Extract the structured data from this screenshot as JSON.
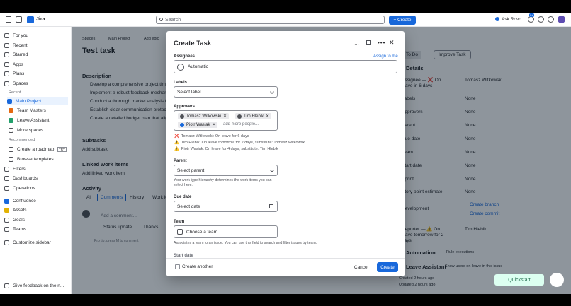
{
  "topbar": {
    "app_name": "Jira",
    "search_placeholder": "Search",
    "create_label": "+ Create",
    "ask_rovo": "Ask Rovo",
    "notif_count": "9+"
  },
  "sidebar": {
    "items": [
      {
        "label": "For you"
      },
      {
        "label": "Recent"
      },
      {
        "label": "Starred"
      },
      {
        "label": "Apps"
      },
      {
        "label": "Plans"
      },
      {
        "label": "Spaces"
      }
    ],
    "recent_heading": "Recent",
    "recent": [
      "Main Project",
      "Team Masters",
      "Leave Assistant",
      "More spaces"
    ],
    "recommended_heading": "Recommended",
    "recommended": [
      "Create a roadmap",
      "Browse templates"
    ],
    "try_badge": "TRY",
    "bottom": [
      "Filters",
      "Dashboards",
      "Operations",
      "Confluence",
      "Assets",
      "Goals",
      "Teams",
      "Customize sidebar"
    ],
    "feedback": "Give feedback on the n..."
  },
  "page": {
    "breadcrumb": [
      "Spaces",
      "Main Project",
      "Add epic"
    ],
    "title": "Test task",
    "description_heading": "Description",
    "description_items": [
      "Develop a comprehensive project timel...",
      "Implement a robust feedback mechan...",
      "Conduct a thorough market analysis to...",
      "Establish clear communication protoco...",
      "Create a detailed budget plan that align..."
    ],
    "subtasks": "Subtasks",
    "add_subtask": "Add subtask",
    "linked": "Linked work items",
    "add_linked": "Add linked work item",
    "activity": "Activity",
    "activity_tabs": [
      "All",
      "Comments",
      "History",
      "Work lo..."
    ],
    "comment_placeholder": "Add a comment...",
    "quick": [
      "Status update...",
      "Thanks..."
    ],
    "pro_tip": "Pro tip: press  M  to comment"
  },
  "details": {
    "status": "To Do",
    "improve": "Improve Task",
    "heading": "Details",
    "rows": [
      {
        "k": "Assignee — ❌ On leave in 6 days",
        "v": "Tomasz Witkowski"
      },
      {
        "k": "Labels",
        "v": "None"
      },
      {
        "k": "Approvers",
        "v": "None"
      },
      {
        "k": "Parent",
        "v": "None"
      },
      {
        "k": "Due date",
        "v": "None"
      },
      {
        "k": "Team",
        "v": "None"
      },
      {
        "k": "Start date",
        "v": "None"
      },
      {
        "k": "Sprint",
        "v": "None"
      },
      {
        "k": "Story point estimate",
        "v": "None"
      },
      {
        "k": "Development",
        "v": ""
      },
      {
        "k": "Reporter — ⚠️ On leave tomorrow for 2 days",
        "v": "Tim Hlebik"
      }
    ],
    "create_branch": "Create branch",
    "create_commit": "Create commit",
    "automation": "Automation",
    "rule_exec": "Rule executions",
    "leave_assistant": "Leave Assistant",
    "show_users": "Show users on leave in this issue",
    "created": "Created 2 hours ago",
    "updated": "Updated 2 hours ago"
  },
  "quickstart": "Quickstart",
  "modal": {
    "title": "Create Task",
    "assignees_label": "Assignees",
    "assign_to_me": "Assign to me",
    "assignee_value": "Automatic",
    "labels_label": "Labels",
    "labels_placeholder": "Select label",
    "approvers_label": "Approvers",
    "approvers": [
      "Tomasz Witkowski",
      "Tim Hlebik",
      "Piotr Wasiak"
    ],
    "add_more": "add more people...",
    "warnings": [
      {
        "icon": "❌",
        "text": "Tomasz Witkowski: On leave for 6 days"
      },
      {
        "icon": "⚠️",
        "text": "Tim Hlebik: On leave tomorrow for 2 days, substitute: Tomasz Witkowski"
      },
      {
        "icon": "⚠️",
        "text": "Piotr Wasiak: On leave for 4 days, substitute: Tim Hlebik"
      }
    ],
    "parent_label": "Parent",
    "parent_placeholder": "Select parent",
    "parent_help": "Your work type hierarchy determines the work items you can select here.",
    "due_label": "Due date",
    "due_placeholder": "Select date",
    "team_label": "Team",
    "team_placeholder": "Choose a team",
    "team_help": "Associates a team to an issue. You can use this field to search and filter issues by team.",
    "start_label": "Start date",
    "create_another": "Create another",
    "cancel": "Cancel",
    "create": "Create"
  }
}
